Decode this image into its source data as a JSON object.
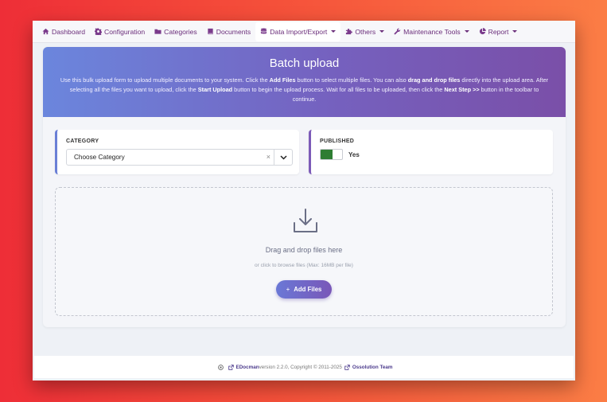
{
  "nav": {
    "items": [
      {
        "label": "Dashboard",
        "icon": "home-icon",
        "dropdown": false
      },
      {
        "label": "Configuration",
        "icon": "gear-icon",
        "dropdown": false
      },
      {
        "label": "Categories",
        "icon": "folder-icon",
        "dropdown": false
      },
      {
        "label": "Documents",
        "icon": "book-icon",
        "dropdown": false
      },
      {
        "label": "Data Import/Export",
        "icon": "database-icon",
        "dropdown": true,
        "active": true
      },
      {
        "label": "Others",
        "icon": "puzzle-icon",
        "dropdown": true
      },
      {
        "label": "Maintenance Tools",
        "icon": "wrench-icon",
        "dropdown": true
      },
      {
        "label": "Report",
        "icon": "pie-chart-icon",
        "dropdown": true
      }
    ]
  },
  "header": {
    "title": "Batch upload",
    "desc_1": "Use this bulk upload form to upload multiple documents to your system. Click the ",
    "desc_b1": "Add Files",
    "desc_2": " button to select multiple files. You can also ",
    "desc_b2": "drag and drop files",
    "desc_3": " directly into the upload area. After selecting all the files you want to upload, click the ",
    "desc_b3": "Start Upload",
    "desc_4": " button to begin the upload process. Wait for all files to be uploaded, then click the ",
    "desc_b4": "Next Step >>",
    "desc_5": " button in the toolbar to continue."
  },
  "category": {
    "label": "CATEGORY",
    "selected": "Choose Category",
    "clear": "×"
  },
  "published": {
    "label": "PUBLISHED",
    "value": "Yes"
  },
  "dropzone": {
    "title": "Drag and drop files here",
    "subtitle": "or click to browse files (Max: 16MB per file)",
    "button_label": "Add Files",
    "button_icon": "+"
  },
  "footer": {
    "app_name": "EDocman",
    "version_text": " version 2.2.0, Copyright © 2011-2025 ",
    "company": "Ossolution Team"
  },
  "colors": {
    "nav_text": "#6a2d7a",
    "hero_start": "#6b86dd",
    "hero_end": "#7a4fa8",
    "toggle_on": "#2e7d32"
  }
}
